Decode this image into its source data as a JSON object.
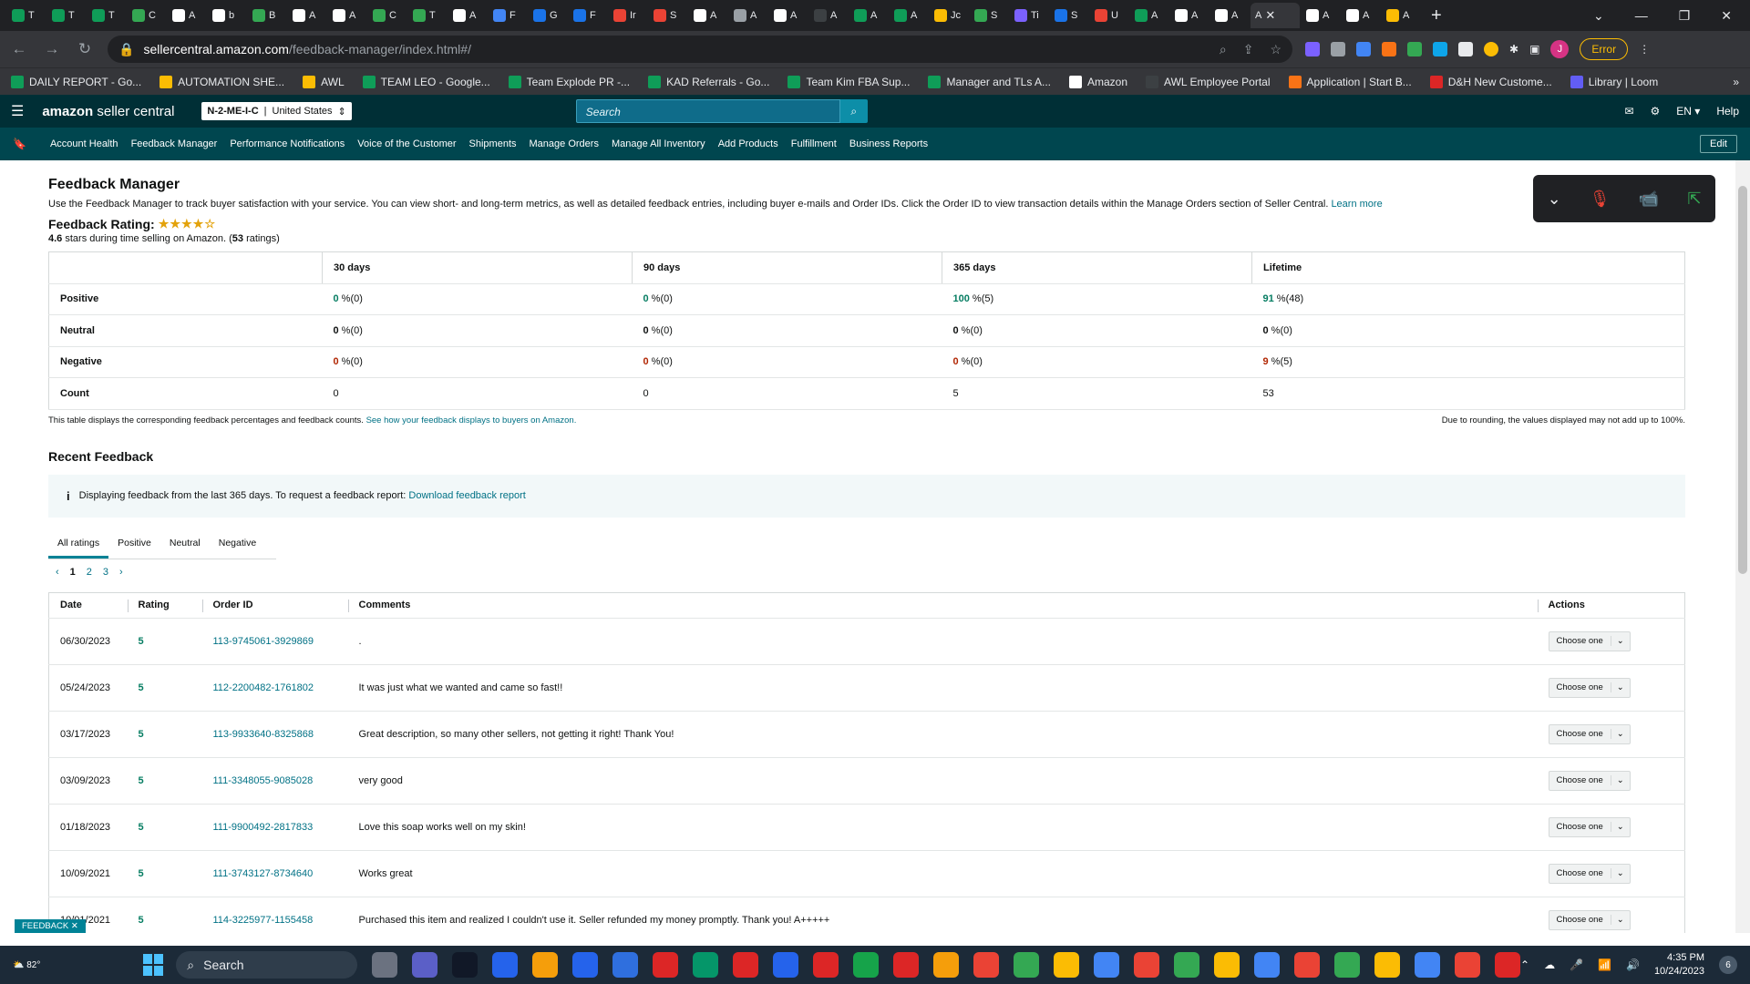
{
  "browser": {
    "tabs": [
      {
        "label": "T",
        "color": "#0f9d58"
      },
      {
        "label": "T",
        "color": "#0f9d58"
      },
      {
        "label": "T",
        "color": "#0f9d58"
      },
      {
        "label": "C",
        "color": "#34a853"
      },
      {
        "label": "A",
        "color": "#ffffff"
      },
      {
        "label": "b",
        "color": "#ffffff"
      },
      {
        "label": "B",
        "color": "#34a853"
      },
      {
        "label": "A",
        "color": "#ffffff"
      },
      {
        "label": "A",
        "color": "#ffffff"
      },
      {
        "label": "C",
        "color": "#34a853"
      },
      {
        "label": "T",
        "color": "#34a853"
      },
      {
        "label": "A",
        "color": "#ffffff"
      },
      {
        "label": "F",
        "color": "#4285f4"
      },
      {
        "label": "G",
        "color": "#1a73e8"
      },
      {
        "label": "F",
        "color": "#1a73e8"
      },
      {
        "label": "Ir",
        "color": "#ea4335"
      },
      {
        "label": "S",
        "color": "#ea4335"
      },
      {
        "label": "A",
        "color": "#ffffff"
      },
      {
        "label": "A",
        "color": "#9aa0a6"
      },
      {
        "label": "A",
        "color": "#ffffff"
      },
      {
        "label": "A",
        "color": "#3c4043"
      },
      {
        "label": "A",
        "color": "#0f9d58"
      },
      {
        "label": "A",
        "color": "#0f9d58"
      },
      {
        "label": "Jc",
        "color": "#fbbc04"
      },
      {
        "label": "S",
        "color": "#34a853"
      },
      {
        "label": "Ti",
        "color": "#7b61ff"
      },
      {
        "label": "S",
        "color": "#1a73e8"
      },
      {
        "label": "U",
        "color": "#ea4335"
      },
      {
        "label": "A",
        "color": "#0f9d58"
      },
      {
        "label": "A",
        "color": "#ffffff"
      },
      {
        "label": "A",
        "color": "#ffffff"
      }
    ],
    "active_tab": "A",
    "after_tabs": [
      {
        "label": "A",
        "color": "#ffffff"
      },
      {
        "label": "A",
        "color": "#ffffff"
      },
      {
        "label": "A",
        "color": "#fbbc04"
      }
    ],
    "url_host": "sellercentral.amazon.com",
    "url_path": "/feedback-manager/index.html#/",
    "error_label": "Error",
    "profile_initial": "J",
    "bookmarks": [
      {
        "label": "DAILY REPORT - Go...",
        "color": "#0f9d58"
      },
      {
        "label": "AUTOMATION SHE...",
        "color": "#fbbc04"
      },
      {
        "label": "AWL",
        "color": "#fbbc04"
      },
      {
        "label": "TEAM LEO - Google...",
        "color": "#0f9d58"
      },
      {
        "label": "Team Explode PR -...",
        "color": "#0f9d58"
      },
      {
        "label": "KAD Referrals - Go...",
        "color": "#0f9d58"
      },
      {
        "label": "Team Kim FBA Sup...",
        "color": "#0f9d58"
      },
      {
        "label": "Manager and TLs A...",
        "color": "#0f9d58"
      },
      {
        "label": "Amazon",
        "color": "#ffffff"
      },
      {
        "label": "AWL Employee Portal",
        "color": "#3c4043"
      },
      {
        "label": "Application | Start B...",
        "color": "#f97316"
      },
      {
        "label": "D&H New Custome...",
        "color": "#dc2626"
      },
      {
        "label": "Library | Loom",
        "color": "#625df5"
      }
    ]
  },
  "header": {
    "logo_main": "amazon",
    "logo_sub": "seller central",
    "marketplace_code": "N-2-ME-I-C",
    "marketplace_country": "United States",
    "search_placeholder": "Search",
    "language": "EN",
    "help": "Help"
  },
  "nav": {
    "items": [
      "Account Health",
      "Feedback Manager",
      "Performance Notifications",
      "Voice of the Customer",
      "Shipments",
      "Manage Orders",
      "Manage All Inventory",
      "Add Products",
      "Fulfillment",
      "Business Reports"
    ],
    "edit": "Edit"
  },
  "page": {
    "title": "Feedback Manager",
    "description": "Use the Feedback Manager to track buyer satisfaction with your service. You can view short- and long-term metrics, as well as detailed feedback entries, including buyer e-mails and Order IDs. Click the Order ID to view transaction details within the Manage Orders section of Seller Central.",
    "learn_more": "Learn more",
    "rating_label": "Feedback Rating:",
    "stars": "★★★★☆",
    "rating_value": "4.6",
    "rating_text": "stars during time selling on Amazon. (",
    "rating_count": "53",
    "rating_text_end": " ratings)"
  },
  "summary": {
    "columns": [
      "",
      "30 days",
      "90 days",
      "365 days",
      "Lifetime"
    ],
    "rows": [
      {
        "label": "Positive",
        "cells": [
          {
            "v": "0",
            "s": " %(0)"
          },
          {
            "v": "0",
            "s": " %(0)"
          },
          {
            "v": "100",
            "s": " %(5)"
          },
          {
            "v": "91",
            "s": " %(48)"
          }
        ]
      },
      {
        "label": "Neutral",
        "cells": [
          {
            "v": "0",
            "s": " %(0)"
          },
          {
            "v": "0",
            "s": " %(0)"
          },
          {
            "v": "0",
            "s": " %(0)"
          },
          {
            "v": "0",
            "s": " %(0)"
          }
        ]
      },
      {
        "label": "Negative",
        "cells": [
          {
            "v": "0",
            "s": " %(0)"
          },
          {
            "v": "0",
            "s": " %(0)"
          },
          {
            "v": "0",
            "s": " %(0)"
          },
          {
            "v": "9",
            "s": " %(5)"
          }
        ]
      },
      {
        "label": "Count",
        "cells": [
          {
            "v": "0",
            "s": ""
          },
          {
            "v": "0",
            "s": ""
          },
          {
            "v": "5",
            "s": ""
          },
          {
            "v": "53",
            "s": ""
          }
        ]
      }
    ],
    "note_left": "This table displays the corresponding feedback percentages and feedback counts.",
    "note_link": "See how your feedback displays to buyers on Amazon.",
    "note_right": "Due to rounding, the values displayed may not add up to 100%."
  },
  "recent": {
    "title": "Recent Feedback",
    "info_text": "Displaying feedback from the last 365 days. To request a feedback report:",
    "info_link": "Download feedback report",
    "tabs": [
      "All ratings",
      "Positive",
      "Neutral",
      "Negative"
    ],
    "pages": [
      "1",
      "2",
      "3"
    ],
    "columns": [
      "Date",
      "Rating",
      "Order ID",
      "Comments",
      "Actions"
    ],
    "rows": [
      {
        "date": "06/30/2023",
        "rating": "5",
        "order": "113-9745061-3929869",
        "comment": "."
      },
      {
        "date": "05/24/2023",
        "rating": "5",
        "order": "112-2200482-1761802",
        "comment": "It was just what we wanted and came so fast!!"
      },
      {
        "date": "03/17/2023",
        "rating": "5",
        "order": "113-9933640-8325868",
        "comment": "Great description, so many other sellers, not getting it right! Thank You!"
      },
      {
        "date": "03/09/2023",
        "rating": "5",
        "order": "111-3348055-9085028",
        "comment": "very good"
      },
      {
        "date": "01/18/2023",
        "rating": "5",
        "order": "111-9900492-2817833",
        "comment": "Love this soap works well on my skin!"
      },
      {
        "date": "10/09/2021",
        "rating": "5",
        "order": "111-3743127-8734640",
        "comment": "Works great"
      },
      {
        "date": "10/01/2021",
        "rating": "5",
        "order": "114-3225977-1155458",
        "comment": "Purchased this item and realized I couldn't use it. Seller refunded my money promptly. Thank you! A+++++"
      }
    ],
    "action_label": "Choose one"
  },
  "feedback_tag": "FEEDBACK ✕",
  "taskbar": {
    "temp": "82°",
    "search": "Search",
    "time": "4:35 PM",
    "date": "10/24/2023",
    "notif_count": "6"
  }
}
